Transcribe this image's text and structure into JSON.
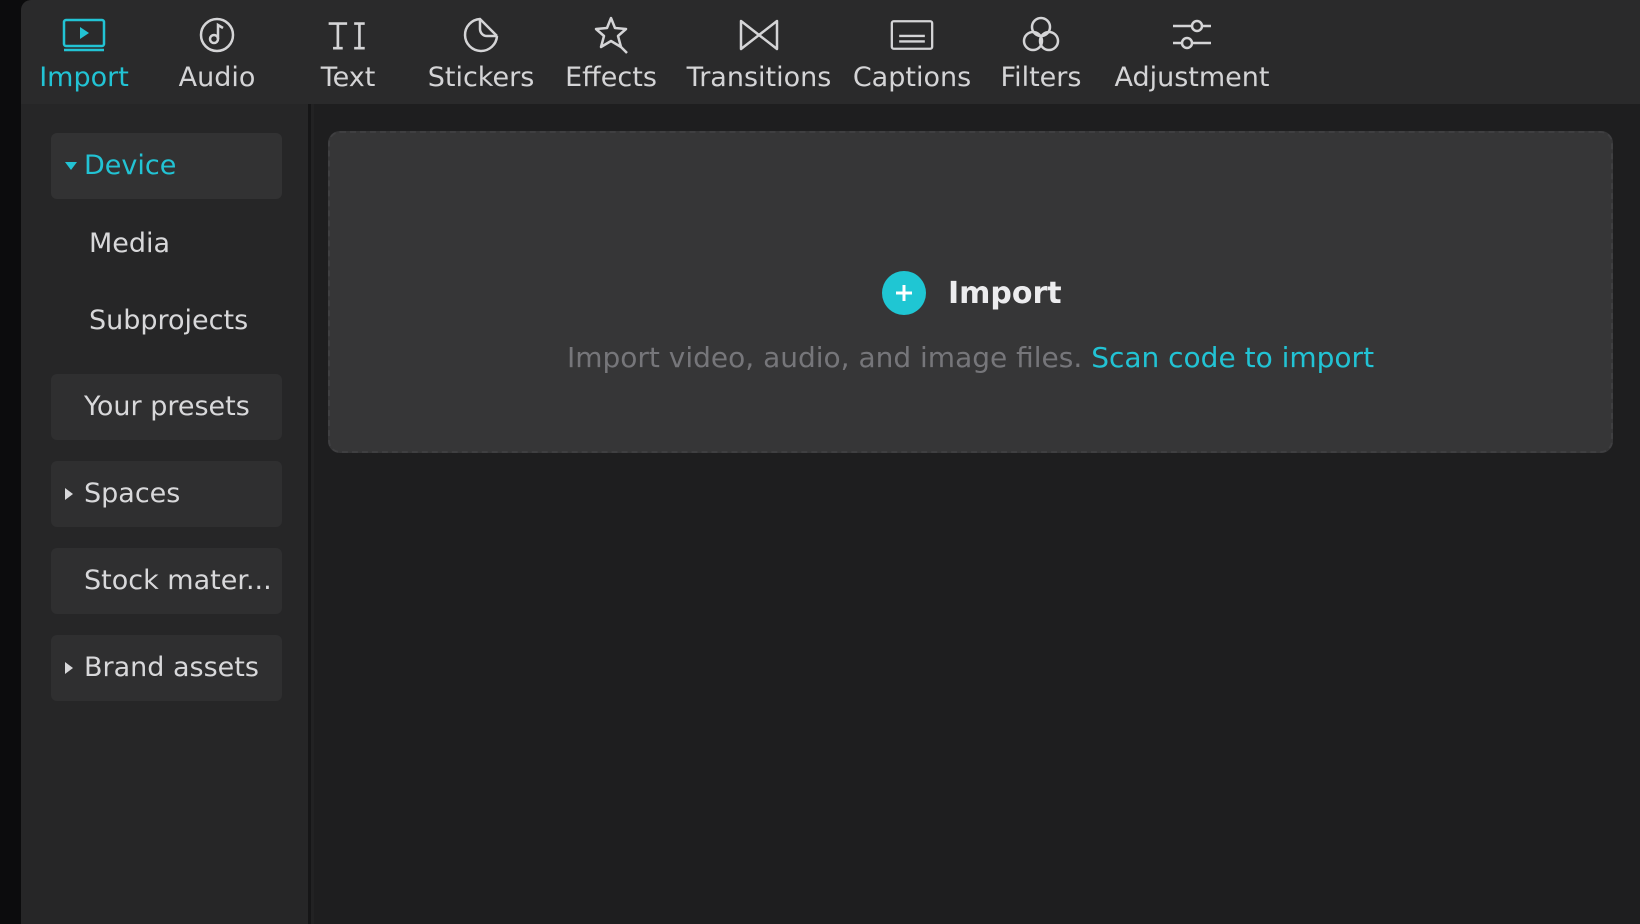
{
  "toolbar": {
    "tabs": [
      {
        "label": "Import",
        "icon": "import-media-icon",
        "active": true
      },
      {
        "label": "Audio",
        "icon": "audio-icon"
      },
      {
        "label": "Text",
        "icon": "text-icon"
      },
      {
        "label": "Stickers",
        "icon": "stickers-icon"
      },
      {
        "label": "Effects",
        "icon": "effects-icon"
      },
      {
        "label": "Transitions",
        "icon": "transitions-icon"
      },
      {
        "label": "Captions",
        "icon": "captions-icon"
      },
      {
        "label": "Filters",
        "icon": "filters-icon"
      },
      {
        "label": "Adjustment",
        "icon": "adjustment-icon"
      }
    ]
  },
  "sidebar": {
    "items": [
      {
        "label": "Device",
        "expanded": true,
        "active": true
      },
      {
        "label": "Media"
      },
      {
        "label": "Subprojects"
      },
      {
        "label": "Your presets"
      },
      {
        "label": "Spaces",
        "expanded": false
      },
      {
        "label": "Stock mater..."
      },
      {
        "label": "Brand assets",
        "expanded": false
      }
    ]
  },
  "main": {
    "import_label": "Import",
    "hint_text": "Import video, audio, and image files.",
    "scan_link": "Scan code to import"
  },
  "colors": {
    "accent": "#22c3d4",
    "background": "#1e1e1f",
    "panel": "#363637"
  }
}
